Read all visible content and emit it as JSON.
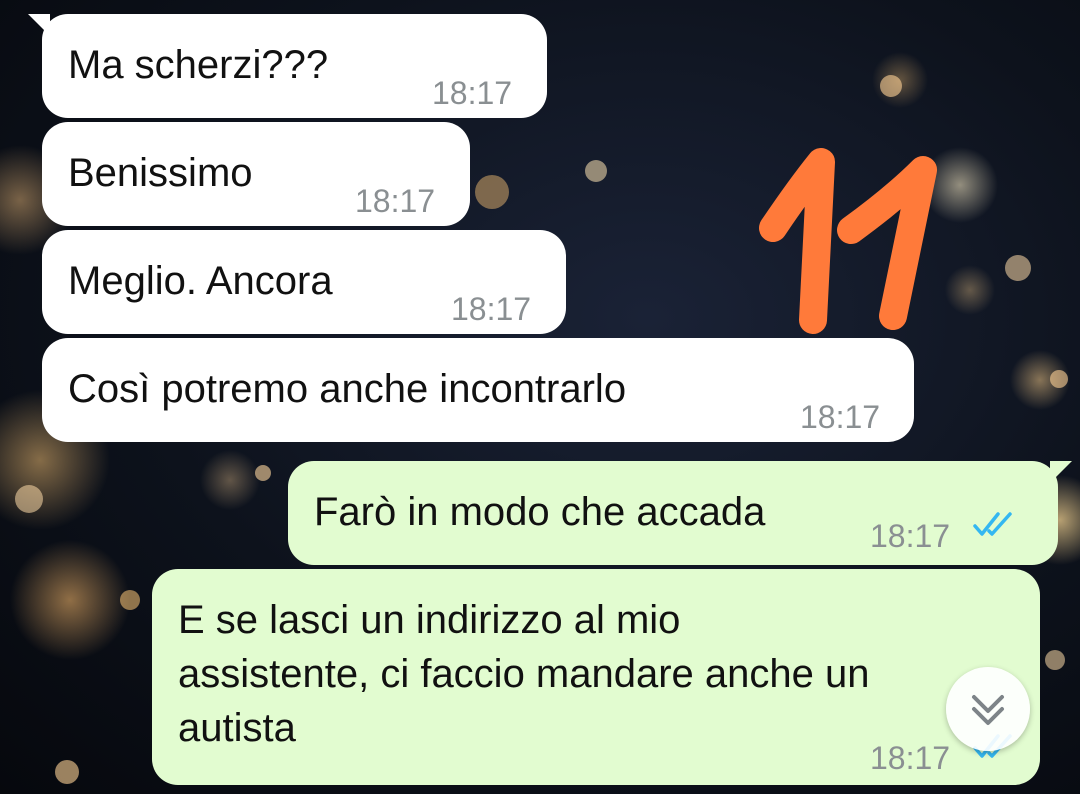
{
  "colors": {
    "incoming_bubble": "#ffffff",
    "outgoing_bubble": "#e2fcd0",
    "read_tick": "#34b7f1",
    "overlay_number": "#ff7a3a"
  },
  "overlay_number": "11",
  "messages": [
    {
      "direction": "incoming",
      "text": "Ma scherzi???",
      "time": "18:17"
    },
    {
      "direction": "incoming",
      "text": "Benissimo",
      "time": "18:17"
    },
    {
      "direction": "incoming",
      "text": "Meglio. Ancora",
      "time": "18:17"
    },
    {
      "direction": "incoming",
      "text": "Così potremo anche incontrarlo",
      "time": "18:17"
    },
    {
      "direction": "outgoing",
      "text": "Farò in modo che accada",
      "time": "18:17",
      "status": "read-double-tick-icon"
    },
    {
      "direction": "outgoing",
      "lines": [
        "E se lasci un indirizzo al mio",
        "assistente, ci faccio mandare anche un",
        "autista"
      ],
      "time": "18:17",
      "status": "read-double-tick-icon"
    }
  ],
  "scroll_button": {
    "icon": "double-chevron-down-icon"
  }
}
